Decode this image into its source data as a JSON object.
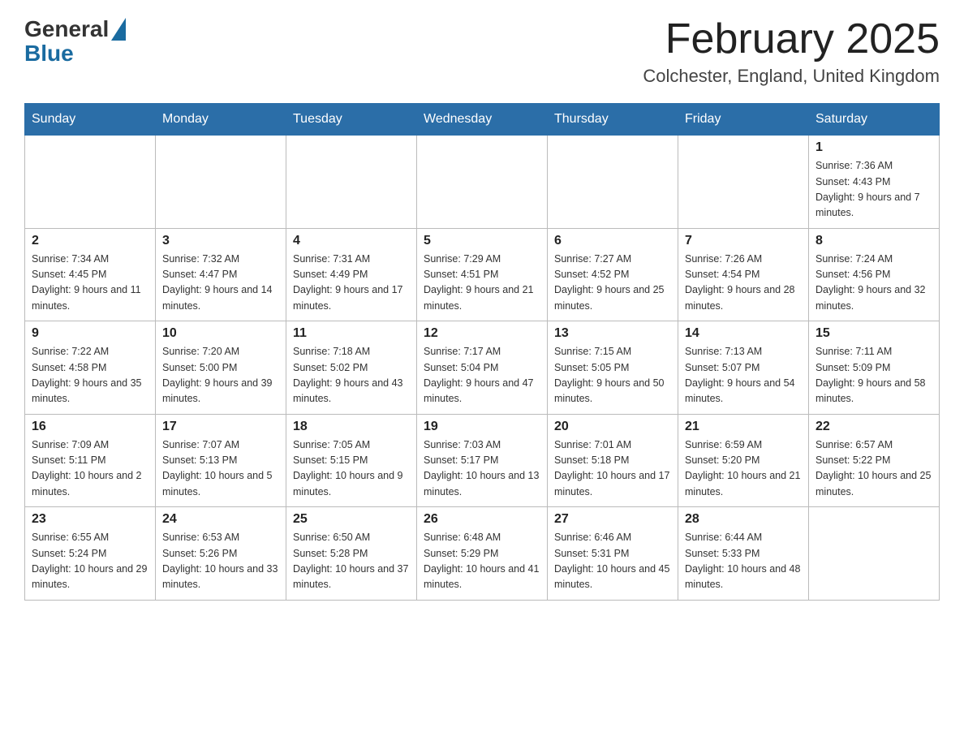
{
  "logo": {
    "text_general": "General",
    "text_blue": "Blue"
  },
  "header": {
    "month_year": "February 2025",
    "location": "Colchester, England, United Kingdom"
  },
  "days_of_week": [
    "Sunday",
    "Monday",
    "Tuesday",
    "Wednesday",
    "Thursday",
    "Friday",
    "Saturday"
  ],
  "weeks": [
    {
      "days": [
        {
          "number": "",
          "info": ""
        },
        {
          "number": "",
          "info": ""
        },
        {
          "number": "",
          "info": ""
        },
        {
          "number": "",
          "info": ""
        },
        {
          "number": "",
          "info": ""
        },
        {
          "number": "",
          "info": ""
        },
        {
          "number": "1",
          "info": "Sunrise: 7:36 AM\nSunset: 4:43 PM\nDaylight: 9 hours and 7 minutes."
        }
      ]
    },
    {
      "days": [
        {
          "number": "2",
          "info": "Sunrise: 7:34 AM\nSunset: 4:45 PM\nDaylight: 9 hours and 11 minutes."
        },
        {
          "number": "3",
          "info": "Sunrise: 7:32 AM\nSunset: 4:47 PM\nDaylight: 9 hours and 14 minutes."
        },
        {
          "number": "4",
          "info": "Sunrise: 7:31 AM\nSunset: 4:49 PM\nDaylight: 9 hours and 17 minutes."
        },
        {
          "number": "5",
          "info": "Sunrise: 7:29 AM\nSunset: 4:51 PM\nDaylight: 9 hours and 21 minutes."
        },
        {
          "number": "6",
          "info": "Sunrise: 7:27 AM\nSunset: 4:52 PM\nDaylight: 9 hours and 25 minutes."
        },
        {
          "number": "7",
          "info": "Sunrise: 7:26 AM\nSunset: 4:54 PM\nDaylight: 9 hours and 28 minutes."
        },
        {
          "number": "8",
          "info": "Sunrise: 7:24 AM\nSunset: 4:56 PM\nDaylight: 9 hours and 32 minutes."
        }
      ]
    },
    {
      "days": [
        {
          "number": "9",
          "info": "Sunrise: 7:22 AM\nSunset: 4:58 PM\nDaylight: 9 hours and 35 minutes."
        },
        {
          "number": "10",
          "info": "Sunrise: 7:20 AM\nSunset: 5:00 PM\nDaylight: 9 hours and 39 minutes."
        },
        {
          "number": "11",
          "info": "Sunrise: 7:18 AM\nSunset: 5:02 PM\nDaylight: 9 hours and 43 minutes."
        },
        {
          "number": "12",
          "info": "Sunrise: 7:17 AM\nSunset: 5:04 PM\nDaylight: 9 hours and 47 minutes."
        },
        {
          "number": "13",
          "info": "Sunrise: 7:15 AM\nSunset: 5:05 PM\nDaylight: 9 hours and 50 minutes."
        },
        {
          "number": "14",
          "info": "Sunrise: 7:13 AM\nSunset: 5:07 PM\nDaylight: 9 hours and 54 minutes."
        },
        {
          "number": "15",
          "info": "Sunrise: 7:11 AM\nSunset: 5:09 PM\nDaylight: 9 hours and 58 minutes."
        }
      ]
    },
    {
      "days": [
        {
          "number": "16",
          "info": "Sunrise: 7:09 AM\nSunset: 5:11 PM\nDaylight: 10 hours and 2 minutes."
        },
        {
          "number": "17",
          "info": "Sunrise: 7:07 AM\nSunset: 5:13 PM\nDaylight: 10 hours and 5 minutes."
        },
        {
          "number": "18",
          "info": "Sunrise: 7:05 AM\nSunset: 5:15 PM\nDaylight: 10 hours and 9 minutes."
        },
        {
          "number": "19",
          "info": "Sunrise: 7:03 AM\nSunset: 5:17 PM\nDaylight: 10 hours and 13 minutes."
        },
        {
          "number": "20",
          "info": "Sunrise: 7:01 AM\nSunset: 5:18 PM\nDaylight: 10 hours and 17 minutes."
        },
        {
          "number": "21",
          "info": "Sunrise: 6:59 AM\nSunset: 5:20 PM\nDaylight: 10 hours and 21 minutes."
        },
        {
          "number": "22",
          "info": "Sunrise: 6:57 AM\nSunset: 5:22 PM\nDaylight: 10 hours and 25 minutes."
        }
      ]
    },
    {
      "days": [
        {
          "number": "23",
          "info": "Sunrise: 6:55 AM\nSunset: 5:24 PM\nDaylight: 10 hours and 29 minutes."
        },
        {
          "number": "24",
          "info": "Sunrise: 6:53 AM\nSunset: 5:26 PM\nDaylight: 10 hours and 33 minutes."
        },
        {
          "number": "25",
          "info": "Sunrise: 6:50 AM\nSunset: 5:28 PM\nDaylight: 10 hours and 37 minutes."
        },
        {
          "number": "26",
          "info": "Sunrise: 6:48 AM\nSunset: 5:29 PM\nDaylight: 10 hours and 41 minutes."
        },
        {
          "number": "27",
          "info": "Sunrise: 6:46 AM\nSunset: 5:31 PM\nDaylight: 10 hours and 45 minutes."
        },
        {
          "number": "28",
          "info": "Sunrise: 6:44 AM\nSunset: 5:33 PM\nDaylight: 10 hours and 48 minutes."
        },
        {
          "number": "",
          "info": ""
        }
      ]
    }
  ]
}
